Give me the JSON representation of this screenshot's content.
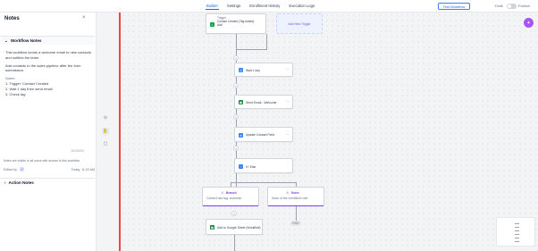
{
  "header": {
    "tabs": [
      {
        "label": "Builder",
        "active": true
      },
      {
        "label": "Settings",
        "active": false
      },
      {
        "label": "Enrollment History",
        "active": false
      },
      {
        "label": "Execution Logs",
        "active": false
      }
    ],
    "test_workflow": "Test Workflow",
    "draft": "Draft",
    "publish": "Publish"
  },
  "panel": {
    "title": "Notes",
    "close": "×",
    "workflow_notes": {
      "heading": "Workflow Notes",
      "paragraphs": [
        "This workflow sends a welcome email to new contacts and notifies the team.",
        "Add contacts to the sales pipeline after the form submission."
      ],
      "sub_label": "Notes",
      "sub_lines": [
        "1. Trigger: Contact Created",
        "2. Wait 1 day then send email",
        "3. Check tag"
      ],
      "counter": "182/5000",
      "disclaimer": "Notes are visible to all users with access to this workflow",
      "edited_by": "Edited by",
      "edited_time": "Today, 11:20 AM"
    },
    "action_notes": {
      "heading": "Action Notes"
    }
  },
  "canvas": {
    "trigger": {
      "label": "Trigger",
      "line1": "Contact Created (Tag Added)",
      "line2": "Add"
    },
    "add_trigger": "Add New Trigger",
    "nodes": [
      {
        "label": "Wait 1 day",
        "icon": "clock-icon",
        "color": "#3b82f6"
      },
      {
        "label": "Send Email - Welcome",
        "icon": "sheets-icon",
        "color": "#15803d"
      },
      {
        "label": "Update Contact Field",
        "icon": "user-icon",
        "color": "#3b82f6"
      },
      {
        "label": "If / Else",
        "icon": "split-icon",
        "color": "#3b82f6"
      }
    ],
    "branches": [
      {
        "title": "Branch",
        "desc": "Contact has tag: customer"
      },
      {
        "title": "None",
        "desc": "None of the conditions met"
      }
    ],
    "bottom_node": {
      "label": "Add to Google Sheet (Workflow)",
      "icon": "sheets-icon",
      "color": "#15803d"
    },
    "end_pill": "END"
  },
  "colors": {
    "accent": "#2563eb",
    "divider": "#ef4444",
    "purple": "#7c3aed"
  }
}
